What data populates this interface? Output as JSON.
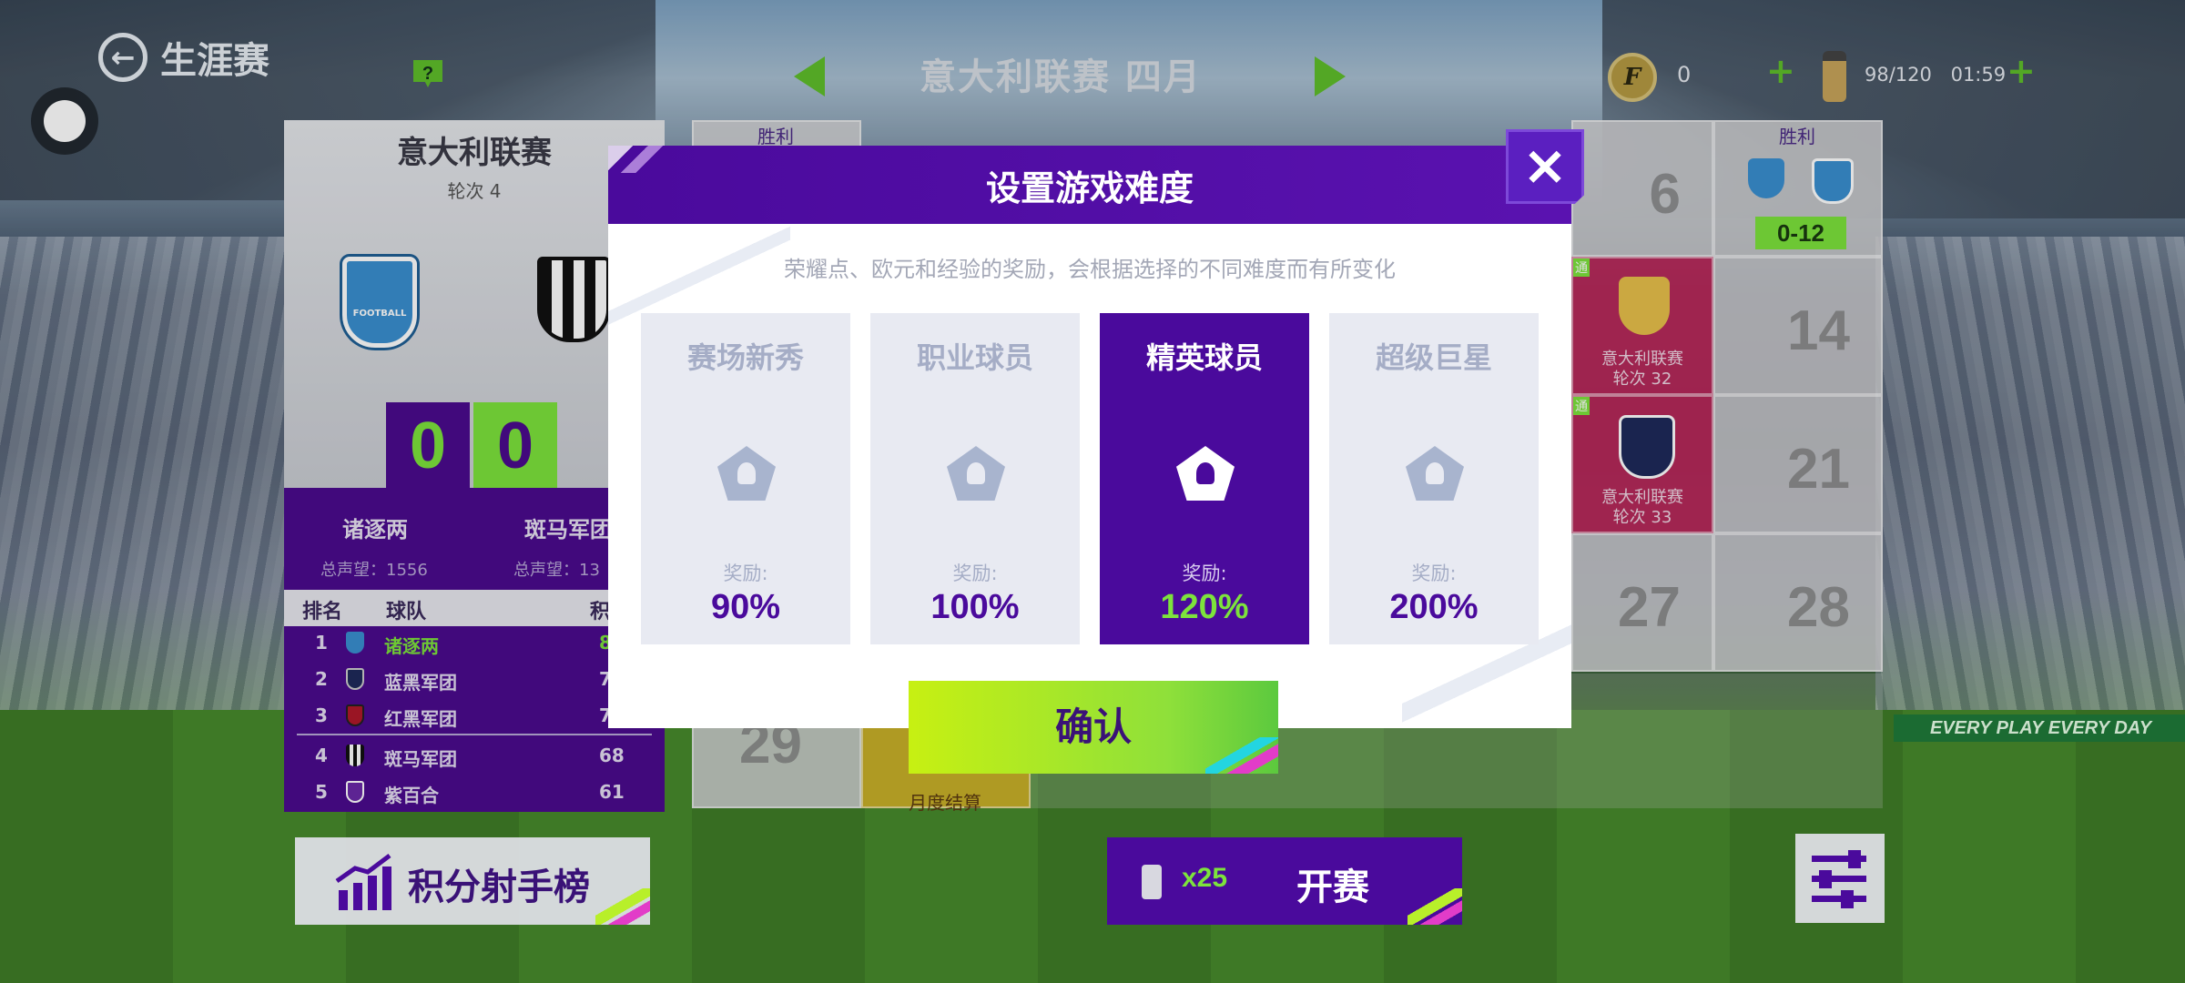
{
  "header": {
    "back_label": "生涯赛",
    "help_label": "?",
    "league_month": "意大利联赛  四月",
    "coins": "0",
    "coin_symbol": "F",
    "energy": "98/120",
    "timer": "01:59",
    "plus": "+"
  },
  "match_panel": {
    "league": "意大利联赛",
    "round": "轮次 4",
    "home_score": "0",
    "away_score": "0",
    "home_team": "诸逐两",
    "away_team": "斑马军团",
    "home_rep": "总声望：1556",
    "away_rep": "总声望：13",
    "crest_text": "FOOTBALL",
    "table_headers": [
      "排名",
      "球队",
      "积"
    ],
    "standings": [
      {
        "rank": "1",
        "team": "诸逐两",
        "points": "8",
        "color": "#3a8fd0",
        "highlight": true
      },
      {
        "rank": "2",
        "team": "蓝黑军团",
        "points": "7",
        "color": "#1e2a5a",
        "highlight": false
      },
      {
        "rank": "3",
        "team": "红黑军团",
        "points": "7",
        "color": "#b0182a",
        "highlight": false
      },
      {
        "rank": "4",
        "team": "斑马军团",
        "points": "68",
        "color": "#ffffff",
        "highlight": false
      },
      {
        "rank": "5",
        "team": "紫百合",
        "points": "61",
        "color": "#6a2aa8",
        "highlight": false
      }
    ]
  },
  "calendar": {
    "win_label": "胜利",
    "win_label_right": "胜利",
    "score_right": "0-12",
    "cells": [
      {
        "num": "6"
      },
      {
        "num": "14"
      },
      {
        "num": "21"
      },
      {
        "num": "27"
      },
      {
        "num": "28"
      },
      {
        "num": "29"
      }
    ],
    "red_cells": [
      {
        "caption1": "意大利联赛",
        "caption2": "轮次 32",
        "corner": "通"
      },
      {
        "caption1": "意大利联赛",
        "caption2": "轮次 33",
        "corner": "通"
      }
    ],
    "monthly": "月度结算"
  },
  "modal": {
    "title": "设置游戏难度",
    "close": "×",
    "description": "荣耀点、欧元和经验的奖励，会根据选择的不同难度而有所变化",
    "options": [
      {
        "name": "赛场新秀",
        "reward_label": "奖励:",
        "reward": "90%",
        "icon": "rookie-icon",
        "selected": false
      },
      {
        "name": "职业球员",
        "reward_label": "奖励:",
        "reward": "100%",
        "icon": "pro-player-icon",
        "selected": false
      },
      {
        "name": "精英球员",
        "reward_label": "奖励:",
        "reward": "120%",
        "icon": "elite-player-icon",
        "selected": true
      },
      {
        "name": "超级巨星",
        "reward_label": "奖励:",
        "reward": "200%",
        "icon": "superstar-icon",
        "selected": false
      }
    ],
    "confirm": "确认"
  },
  "footer": {
    "leaderboard": "积分射手榜",
    "start_cost": "x25",
    "start": "开赛"
  },
  "stadium_banner": "EVERY PLAY EVERY DAY",
  "colors": {
    "accent_purple": "#4a0a9c",
    "accent_green": "#7de33c",
    "confirm_yellow": "#c7f012"
  }
}
